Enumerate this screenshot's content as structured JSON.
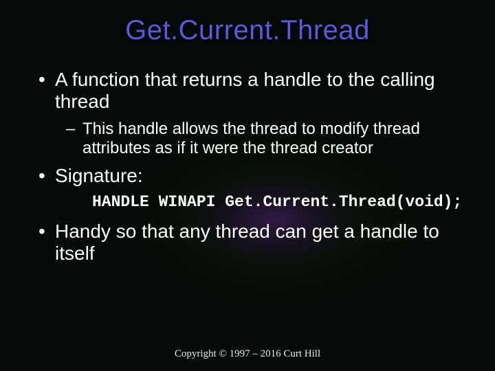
{
  "title": "Get.Current.Thread",
  "bullets": {
    "b1": "A function that returns a handle to the calling thread",
    "b1_sub1": "This handle allows the thread to modify thread attributes as if it were the thread creator",
    "b2": "Signature:",
    "b2_code": "HANDLE WINAPI Get.Current.Thread(void);",
    "b3": "Handy so that any thread can get a handle to itself"
  },
  "footer": "Copyright © 1997 – 2016 Curt Hill"
}
